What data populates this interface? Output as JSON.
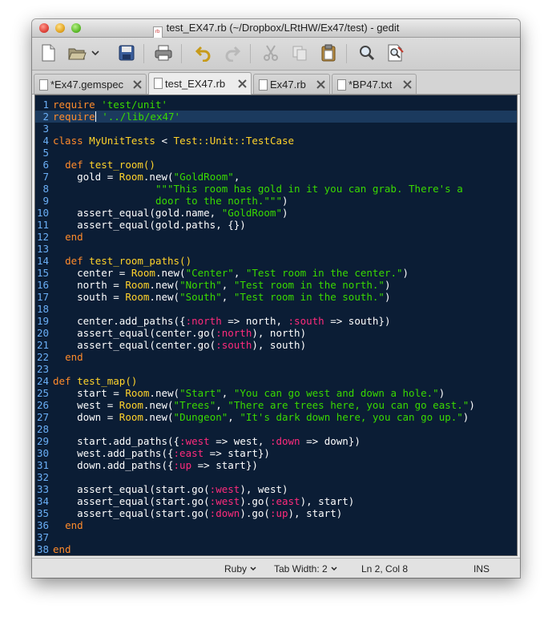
{
  "window": {
    "title": "test_EX47.rb (~/Dropbox/LRtHW/Ex47/test) - gedit",
    "title_icon_text": "rb"
  },
  "toolbar": {
    "buttons": [
      "new-document-icon",
      "open-folder-icon",
      "dropdown-arrow-icon",
      "save-icon",
      "print-icon",
      "undo-icon",
      "redo-icon",
      "cut-icon",
      "copy-icon",
      "paste-icon",
      "find-icon",
      "find-replace-icon"
    ]
  },
  "tabs": [
    {
      "label": "*Ex47.gemspec",
      "active": false
    },
    {
      "label": "test_EX47.rb",
      "active": true
    },
    {
      "label": "Ex47.rb",
      "active": false
    },
    {
      "label": "*BP47.txt",
      "active": false
    }
  ],
  "editor": {
    "current_line": 2,
    "theme_colors": {
      "background": "#0b1d35",
      "keyword": "#ff8b2b",
      "string": "#3ad900",
      "symbol": "#ff2b7c",
      "class": "#ffd32b",
      "linenumber": "#6aaef5"
    },
    "lines": [
      [
        [
          "kw",
          "require"
        ],
        [
          "p",
          " "
        ],
        [
          "str",
          "'test/unit'"
        ]
      ],
      [
        [
          "kw",
          "require"
        ],
        [
          "p",
          " "
        ],
        [
          "str",
          "'../lib/ex47'"
        ]
      ],
      [],
      [
        [
          "kw",
          "class"
        ],
        [
          "p",
          " "
        ],
        [
          "cls",
          "MyUnitTests"
        ],
        [
          "p",
          " < "
        ],
        [
          "cls",
          "Test::Unit::TestCase"
        ]
      ],
      [],
      [
        [
          "p",
          "  "
        ],
        [
          "kw",
          "def"
        ],
        [
          "p",
          " "
        ],
        [
          "fn",
          "test_room()"
        ]
      ],
      [
        [
          "p",
          "    gold = "
        ],
        [
          "cls",
          "Room"
        ],
        [
          "p",
          ".new("
        ],
        [
          "str",
          "\"GoldRoom\""
        ],
        [
          "p",
          ","
        ]
      ],
      [
        [
          "p",
          "                 "
        ],
        [
          "str",
          "\"\"\"This room has gold in it you can grab. There's a"
        ]
      ],
      [
        [
          "p",
          "                 "
        ],
        [
          "str",
          "door to the north.\"\"\""
        ],
        [
          "p",
          ")"
        ]
      ],
      [
        [
          "p",
          "    assert_equal(gold.name, "
        ],
        [
          "str",
          "\"GoldRoom\""
        ],
        [
          "p",
          ")"
        ]
      ],
      [
        [
          "p",
          "    assert_equal(gold.paths, {})"
        ]
      ],
      [
        [
          "p",
          "  "
        ],
        [
          "kw",
          "end"
        ]
      ],
      [],
      [
        [
          "p",
          "  "
        ],
        [
          "kw",
          "def"
        ],
        [
          "p",
          " "
        ],
        [
          "fn",
          "test_room_paths()"
        ]
      ],
      [
        [
          "p",
          "    center = "
        ],
        [
          "cls",
          "Room"
        ],
        [
          "p",
          ".new("
        ],
        [
          "str",
          "\"Center\""
        ],
        [
          "p",
          ", "
        ],
        [
          "str",
          "\"Test room in the center.\""
        ],
        [
          "p",
          ")"
        ]
      ],
      [
        [
          "p",
          "    north = "
        ],
        [
          "cls",
          "Room"
        ],
        [
          "p",
          ".new("
        ],
        [
          "str",
          "\"North\""
        ],
        [
          "p",
          ", "
        ],
        [
          "str",
          "\"Test room in the north.\""
        ],
        [
          "p",
          ")"
        ]
      ],
      [
        [
          "p",
          "    south = "
        ],
        [
          "cls",
          "Room"
        ],
        [
          "p",
          ".new("
        ],
        [
          "str",
          "\"South\""
        ],
        [
          "p",
          ", "
        ],
        [
          "str",
          "\"Test room in the south.\""
        ],
        [
          "p",
          ")"
        ]
      ],
      [],
      [
        [
          "p",
          "    center.add_paths({"
        ],
        [
          "sym",
          ":north"
        ],
        [
          "p",
          " => north, "
        ],
        [
          "sym",
          ":south"
        ],
        [
          "p",
          " => south})"
        ]
      ],
      [
        [
          "p",
          "    assert_equal(center.go("
        ],
        [
          "sym",
          ":north"
        ],
        [
          "p",
          "), north)"
        ]
      ],
      [
        [
          "p",
          "    assert_equal(center.go("
        ],
        [
          "sym",
          ":south"
        ],
        [
          "p",
          "), south)"
        ]
      ],
      [
        [
          "p",
          "  "
        ],
        [
          "kw",
          "end"
        ]
      ],
      [],
      [
        [
          "kw",
          "def"
        ],
        [
          "p",
          " "
        ],
        [
          "fn",
          "test_map()"
        ]
      ],
      [
        [
          "p",
          "    start = "
        ],
        [
          "cls",
          "Room"
        ],
        [
          "p",
          ".new("
        ],
        [
          "str",
          "\"Start\""
        ],
        [
          "p",
          ", "
        ],
        [
          "str",
          "\"You can go west and down a hole.\""
        ],
        [
          "p",
          ")"
        ]
      ],
      [
        [
          "p",
          "    west = "
        ],
        [
          "cls",
          "Room"
        ],
        [
          "p",
          ".new("
        ],
        [
          "str",
          "\"Trees\""
        ],
        [
          "p",
          ", "
        ],
        [
          "str",
          "\"There are trees here, you can go east.\""
        ],
        [
          "p",
          ")"
        ]
      ],
      [
        [
          "p",
          "    down = "
        ],
        [
          "cls",
          "Room"
        ],
        [
          "p",
          ".new("
        ],
        [
          "str",
          "\"Dungeon\""
        ],
        [
          "p",
          ", "
        ],
        [
          "str",
          "\"It's dark down here, you can go up.\""
        ],
        [
          "p",
          ")"
        ]
      ],
      [],
      [
        [
          "p",
          "    start.add_paths({"
        ],
        [
          "sym",
          ":west"
        ],
        [
          "p",
          " => west, "
        ],
        [
          "sym",
          ":down"
        ],
        [
          "p",
          " => down})"
        ]
      ],
      [
        [
          "p",
          "    west.add_paths({"
        ],
        [
          "sym",
          ":east"
        ],
        [
          "p",
          " => start})"
        ]
      ],
      [
        [
          "p",
          "    down.add_paths({"
        ],
        [
          "sym",
          ":up"
        ],
        [
          "p",
          " => start})"
        ]
      ],
      [],
      [
        [
          "p",
          "    assert_equal(start.go("
        ],
        [
          "sym",
          ":west"
        ],
        [
          "p",
          "), west)"
        ]
      ],
      [
        [
          "p",
          "    assert_equal(start.go("
        ],
        [
          "sym",
          ":west"
        ],
        [
          "p",
          ").go("
        ],
        [
          "sym",
          ":east"
        ],
        [
          "p",
          "), start)"
        ]
      ],
      [
        [
          "p",
          "    assert_equal(start.go("
        ],
        [
          "sym",
          ":down"
        ],
        [
          "p",
          ").go("
        ],
        [
          "sym",
          ":up"
        ],
        [
          "p",
          "), start)"
        ]
      ],
      [
        [
          "p",
          "  "
        ],
        [
          "kw",
          "end"
        ]
      ],
      [],
      [
        [
          "kw",
          "end"
        ]
      ]
    ]
  },
  "statusbar": {
    "language": "Ruby",
    "tab_width_label": "Tab Width:",
    "tab_width_value": "2",
    "position": "Ln 2, Col 8",
    "mode": "INS"
  }
}
